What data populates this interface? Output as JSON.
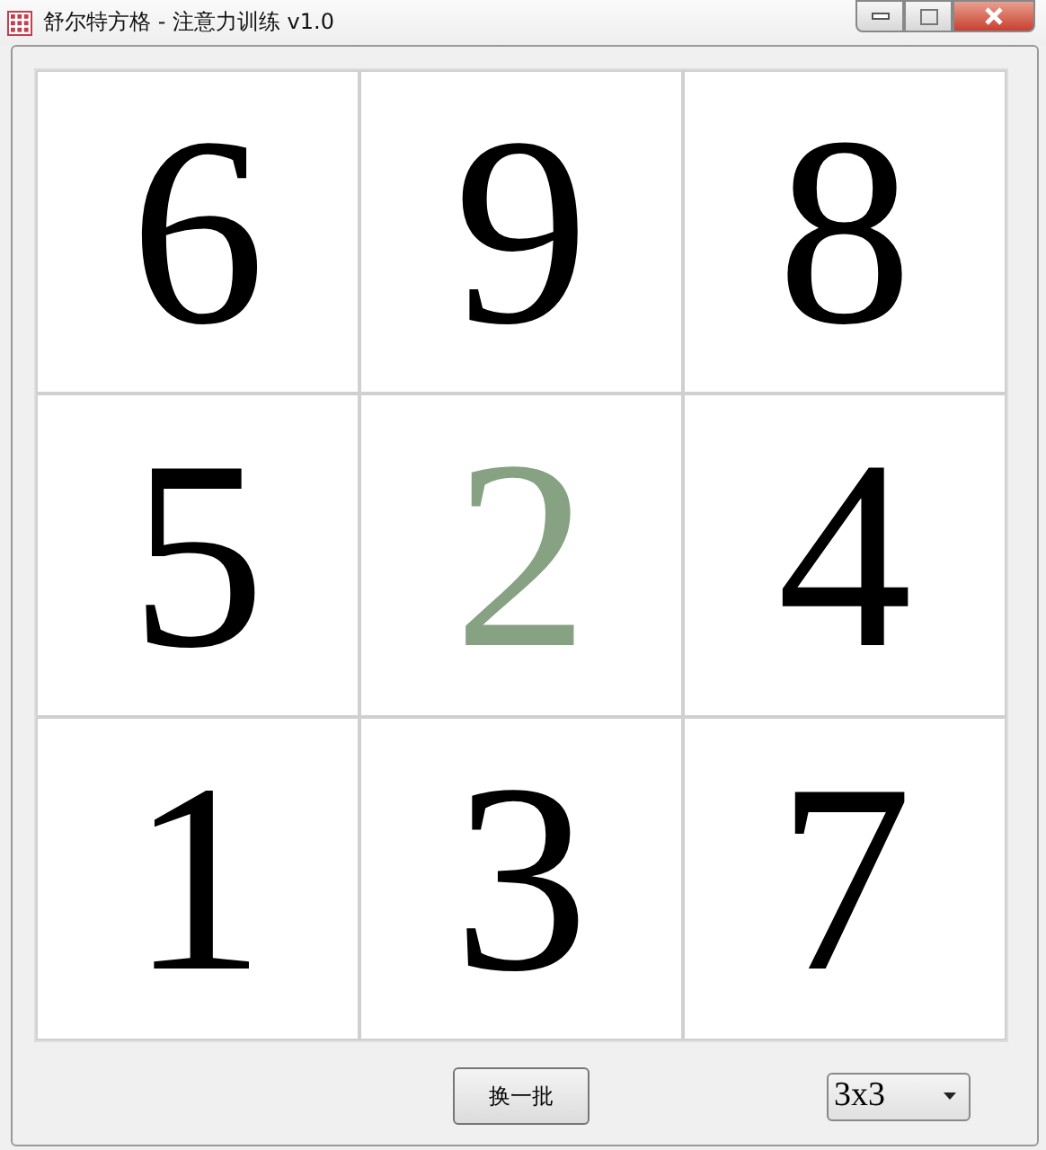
{
  "window": {
    "title": "舒尔特方格 - 注意力训练 v1.0"
  },
  "grid": {
    "cells": [
      {
        "number": "6",
        "selected": false
      },
      {
        "number": "9",
        "selected": false
      },
      {
        "number": "8",
        "selected": false
      },
      {
        "number": "5",
        "selected": false
      },
      {
        "number": "2",
        "selected": true
      },
      {
        "number": "4",
        "selected": false
      },
      {
        "number": "1",
        "selected": false
      },
      {
        "number": "3",
        "selected": false
      },
      {
        "number": "7",
        "selected": false
      }
    ]
  },
  "new_batch_button": {
    "label": "换一批"
  },
  "size_dropdown": {
    "value": "3x3"
  }
}
